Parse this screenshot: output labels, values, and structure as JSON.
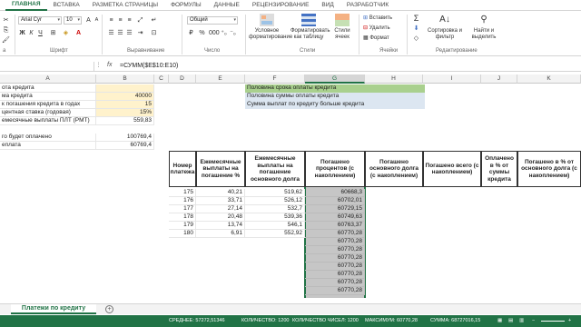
{
  "ribbon_tabs": [
    "ГЛАВНАЯ",
    "ВСТАВКА",
    "РАЗМЕТКА СТРАНИЦЫ",
    "ФОРМУЛЫ",
    "ДАННЫЕ",
    "РЕЦЕНЗИРОВАНИЕ",
    "ВИД",
    "РАЗРАБОТЧИК"
  ],
  "ribbon": {
    "font_name": "Arial Cyr",
    "font_size": "10",
    "number_format": "Общий",
    "group_font": "Шрифт",
    "group_align": "Выравнивание",
    "group_number": "Число",
    "group_styles": "Стили",
    "group_cells": "Ячейки",
    "group_edit": "Редактирование",
    "cond_format": "Условное форматирование",
    "format_table": "Форматировать как таблицу",
    "cell_styles": "Стили ячеек",
    "insert": "Вставить",
    "delete": "Удалить",
    "format": "Формат",
    "sort_filter": "Сортировка и фильтр",
    "find_select": "Найти и выделить",
    "clipboard_label": "а"
  },
  "formula_bar": {
    "fx": "fx",
    "formula": "=СУММ($E$10:E10)"
  },
  "columns": [
    "A",
    "B",
    "C",
    "D",
    "E",
    "F",
    "G",
    "H",
    "I",
    "J",
    "K"
  ],
  "left_block": [
    {
      "label": "ота кредита",
      "value": ""
    },
    {
      "label": "ма кредита",
      "value": "40000"
    },
    {
      "label": "к погашения кредита в годах",
      "value": "15"
    },
    {
      "label": "центная ставка (годовая)",
      "value": "15%"
    },
    {
      "label": "емесячные выплаты ПЛТ (PMT)",
      "value": "559,83"
    },
    {
      "label": "",
      "value": ""
    },
    {
      "label": "го будет оплачено",
      "value": "100769,4"
    },
    {
      "label": "еплата",
      "value": "60769,4"
    }
  ],
  "legend": [
    {
      "text": "Половина срока  оплаты кредита",
      "color": "#a9d08e"
    },
    {
      "text": "Половина суммы оплаты кредита",
      "color": "#dce6f1"
    },
    {
      "text": "Сумма выплат по кредиту больше кредита",
      "color": "#dce6f1"
    }
  ],
  "table_headers": [
    "Номер платежа",
    "Ежемесячные выплаты на погашение %",
    "Ежемесячные выплаты на погашение основного долга",
    "Погашено процентов (с накоплением)",
    "Погашено основного долга (с накоплением)",
    "Погашено всего (с накоплением)",
    "Оплачено в % от суммы кредита",
    "Погашено в % от основного долга (с накоплением)"
  ],
  "table_rows": [
    [
      "175",
      "40,21",
      "519,62",
      "60668,3"
    ],
    [
      "176",
      "33,71",
      "526,12",
      "60702,01"
    ],
    [
      "177",
      "27,14",
      "532,7",
      "60729,15"
    ],
    [
      "178",
      "20,48",
      "539,36",
      "60749,63"
    ],
    [
      "179",
      "13,74",
      "546,1",
      "60763,37"
    ],
    [
      "180",
      "6,91",
      "552,92",
      "60770,28"
    ],
    [
      "",
      "",
      "",
      "60770,28"
    ],
    [
      "",
      "",
      "",
      "60770,28"
    ],
    [
      "",
      "",
      "",
      "60770,28"
    ],
    [
      "",
      "",
      "",
      "60770,28"
    ],
    [
      "",
      "",
      "",
      "60770,28"
    ],
    [
      "",
      "",
      "",
      "60770,28"
    ],
    [
      "",
      "",
      "",
      "60770,28"
    ]
  ],
  "sheet_tab": "Платежи по кредиту",
  "status": {
    "avg": "СРЕДНЕЕ: 57272,51346",
    "count": "КОЛИЧЕСТВО: 1200",
    "count_nums": "КОЛИЧЕСТВО ЧИСЕЛ: 1200",
    "max": "МАКСИМУМ: 60770,28",
    "sum": "СУММА: 68727016,15"
  }
}
